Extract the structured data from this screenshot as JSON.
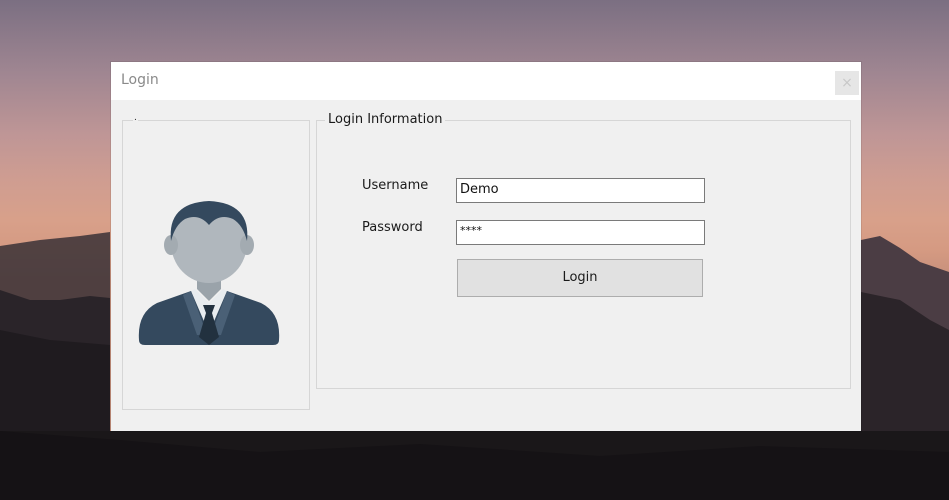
{
  "window": {
    "title": "Login",
    "close_glyph": "×"
  },
  "avatar_panel": {
    "caption": "."
  },
  "login_panel": {
    "caption": "Login Information",
    "username_label": "Username",
    "username_value": "Demo",
    "password_label": "Password",
    "password_value": "****",
    "login_button_label": "Login"
  },
  "icons": {
    "avatar": "user-avatar-icon",
    "close": "close-icon"
  },
  "colors": {
    "window_bg": "#f0f0f0",
    "titlebar_bg": "#ffffff",
    "avatar_dark": "#34495e",
    "avatar_face": "#b0b7bd",
    "button_bg": "#e1e1e1"
  }
}
